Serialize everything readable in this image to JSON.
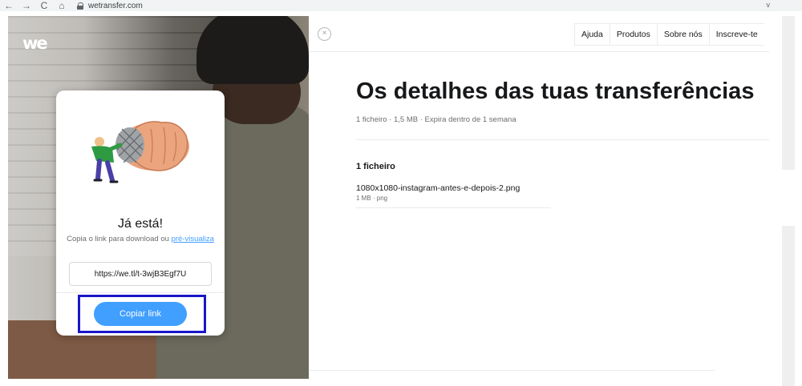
{
  "browser": {
    "url": "wetransfer.com",
    "back_glyph": "←",
    "forward_glyph": "→",
    "reload_glyph": "C",
    "home_glyph": "⌂",
    "caret": "v"
  },
  "brand": {
    "logo_text": "we"
  },
  "card": {
    "title": "Já está!",
    "text_prefix": "Copia o link para download ou ",
    "text_link": "pré-visualiza",
    "link_url": "https://we.tl/t-3wjB3Egf7U",
    "copy_button": "Copiar link",
    "highlight_color": "#1a16c9",
    "button_color": "#409fff"
  },
  "nav": {
    "close_glyph": "×",
    "items": [
      "Ajuda",
      "Produtos",
      "Sobre nós",
      "Inscreve-te"
    ]
  },
  "details": {
    "title": "Os detalhes das tuas transferências",
    "meta": "1 ficheiro · 1,5 MB · Expira dentro de 1 semana",
    "files_heading": "1 ficheiro",
    "file": {
      "name": "1080x1080-instagram-antes-e-depois-2.png",
      "meta": "1 MB · png"
    }
  }
}
